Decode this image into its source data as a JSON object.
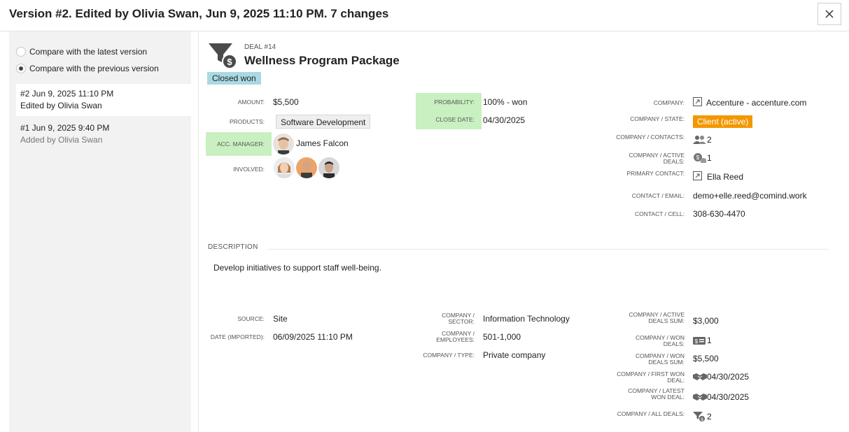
{
  "header": {
    "title": "Version #2. Edited by Olivia Swan, Jun 9, 2025 11:10 PM. 7 changes"
  },
  "compare": {
    "latest_label": "Compare with the latest version",
    "previous_label": "Compare with the previous version",
    "selected": "previous"
  },
  "versions": [
    {
      "line1": "#2 Jun 9, 2025 11:10 PM",
      "line2": "Edited by Olivia Swan",
      "selected": true
    },
    {
      "line1": "#1 Jun 9, 2025 9:40 PM",
      "line2": "Added by Olivia Swan",
      "selected": false
    }
  ],
  "deal": {
    "number": "DEAL #14",
    "title": "Wellness Program Package",
    "status": "Closed won",
    "amount_label": "AMOUNT:",
    "amount": "$5,500",
    "products_label": "PRODUCTS:",
    "product": "Software Development",
    "manager_label": "ACC. MANAGER:",
    "manager": "James Falcon",
    "involved_label": "INVOLVED:",
    "probability_label": "PROBABILITY:",
    "probability": "100% - won",
    "close_date_label": "CLOSE DATE:",
    "close_date": "04/30/2025"
  },
  "company": {
    "company_label": "COMPANY:",
    "company": "Accenture - accenture.com",
    "state_label": "COMPANY / STATE:",
    "state": "Client (active)",
    "contacts_label": "COMPANY / CONTACTS:",
    "contacts": "2",
    "active_deals_label": "COMPANY / ACTIVE DEALS:",
    "active_deals": "1",
    "primary_contact_label": "PRIMARY CONTACT:",
    "primary_contact": "Ella Reed",
    "email_label": "CONTACT / EMAIL:",
    "email": "demo+elle.reed@comind.work",
    "cell_label": "CONTACT / CELL:",
    "cell": "308-630-4470"
  },
  "description": {
    "title": "DESCRIPTION",
    "text": "Develop initiatives to support staff well-being."
  },
  "details": {
    "source_label": "SOURCE:",
    "source": "Site",
    "date_imported_label": "DATE (IMPORTED):",
    "date_imported": "06/09/2025 11:10 PM",
    "sector_label": "COMPANY / SECTOR:",
    "sector": "Information Technology",
    "employees_label": "COMPANY / EMPLOYEES:",
    "employees": "501-1,000",
    "type_label": "COMPANY / TYPE:",
    "type": "Private company",
    "active_sum_label": "COMPANY / ACTIVE DEALS SUM:",
    "active_sum": "$3,000",
    "won_deals_label": "COMPANY / WON DEALS:",
    "won_deals": "1",
    "won_sum_label": "COMPANY / WON DEALS SUM:",
    "won_sum": "$5,500",
    "first_won_label": "COMPANY / FIRST WON DEAL:",
    "first_won": "04/30/2025",
    "latest_won_label": "COMPANY / LATEST WON DEAL:",
    "latest_won": "04/30/2025",
    "all_deals_label": "COMPANY / ALL DEALS:",
    "all_deals": "2"
  },
  "colors": {
    "highlight": "#c9f0c0",
    "status_tag": "#a9d9e3",
    "state_tag": "#f39700"
  }
}
